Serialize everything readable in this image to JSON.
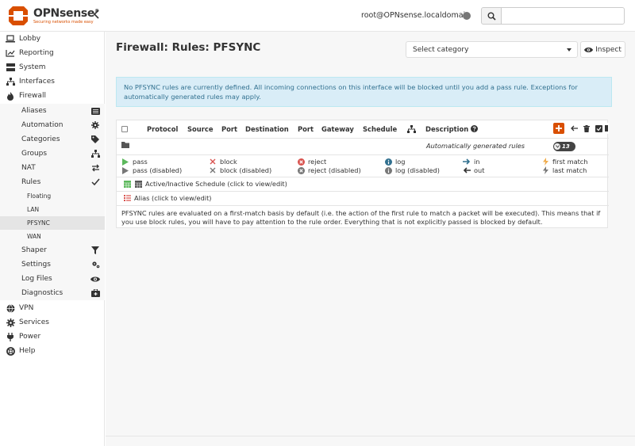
{
  "brand": {
    "name": "OPNsense",
    "reg": "®",
    "tagline": "Securing networks made easy",
    "accent": "#d94f00"
  },
  "header": {
    "user": "root@OPNsense.localdomain",
    "search_placeholder": "",
    "icons": [
      "collapse-icon",
      "status-dot",
      "search-icon"
    ]
  },
  "sidebar": {
    "top_items": [
      {
        "label": "Lobby",
        "icon": "laptop-icon"
      },
      {
        "label": "Reporting",
        "icon": "chart-icon"
      },
      {
        "label": "System",
        "icon": "server-icon"
      },
      {
        "label": "Interfaces",
        "icon": "sitemap-icon"
      },
      {
        "label": "Firewall",
        "icon": "fire-icon"
      }
    ],
    "firewall_items": [
      {
        "label": "Aliases",
        "icon": "list-icon"
      },
      {
        "label": "Automation",
        "icon": "gear-icon"
      },
      {
        "label": "Categories",
        "icon": "tags-icon"
      },
      {
        "label": "Groups",
        "icon": "sitemap-icon"
      },
      {
        "label": "NAT",
        "icon": "exchange-icon"
      },
      {
        "label": "Rules",
        "icon": "check-icon"
      }
    ],
    "rules_items": [
      {
        "label": "Floating"
      },
      {
        "label": "LAN"
      },
      {
        "label": "PFSYNC"
      },
      {
        "label": "WAN"
      }
    ],
    "firewall_items_2": [
      {
        "label": "Shaper",
        "icon": "filter-icon"
      },
      {
        "label": "Settings",
        "icon": "gears-icon"
      },
      {
        "label": "Log Files",
        "icon": "eye-icon"
      },
      {
        "label": "Diagnostics",
        "icon": "medkit-icon"
      }
    ],
    "bottom_items": [
      {
        "label": "VPN",
        "icon": "globe-icon"
      },
      {
        "label": "Services",
        "icon": "cog-icon"
      },
      {
        "label": "Power",
        "icon": "plug-icon"
      },
      {
        "label": "Help",
        "icon": "lifebuoy-icon"
      }
    ]
  },
  "main": {
    "title": "Firewall: Rules: PFSYNC",
    "category_select": "Select category",
    "inspect_label": "Inspect",
    "alert": "No PFSYNC rules are currently defined. All incoming connections on this interface will be blocked until you add a pass rule. Exceptions for automatically generated rules may apply.",
    "columns": [
      "Protocol",
      "Source",
      "Port",
      "Destination",
      "Port",
      "Gateway",
      "Schedule",
      "",
      "Description"
    ],
    "auto_rules_label": "Automatically generated rules",
    "auto_rules_count": "13",
    "legend": [
      {
        "label": "pass",
        "icon": "play-icon",
        "color": "#5cb85c"
      },
      {
        "label": "block",
        "icon": "times-icon",
        "color": "#d9534f"
      },
      {
        "label": "reject",
        "icon": "times-circle-icon",
        "color": "#d9534f"
      },
      {
        "label": "log",
        "icon": "info-circle-icon",
        "color": "#31708f"
      },
      {
        "label": "in",
        "icon": "arrow-right-icon",
        "color": "#31708f"
      },
      {
        "label": "first match",
        "icon": "bolt-icon",
        "color": "#f0ad4e"
      },
      {
        "label": "pass (disabled)",
        "icon": "play-icon",
        "color": "#777"
      },
      {
        "label": "block (disabled)",
        "icon": "times-icon",
        "color": "#777"
      },
      {
        "label": "reject (disabled)",
        "icon": "times-circle-icon",
        "color": "#777"
      },
      {
        "label": "log (disabled)",
        "icon": "info-circle-icon",
        "color": "#777"
      },
      {
        "label": "out",
        "icon": "arrow-left-icon",
        "color": "#333"
      },
      {
        "label": "last match",
        "icon": "bolt-icon",
        "color": "#777"
      }
    ],
    "schedule_legend": "Active/Inactive Schedule (click to view/edit)",
    "alias_legend": "Alias (click to view/edit)",
    "info": "PFSYNC rules are evaluated on a first-match basis by default (i.e. the action of the first rule to match a packet will be executed). This means that if you use block rules, you will have to pay attention to the rule order. Everything that is not explicitly passed is blocked by default."
  }
}
